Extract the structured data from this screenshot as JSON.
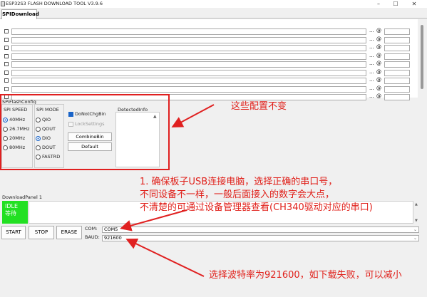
{
  "window": {
    "title": "ESP32S3 FLASH DOWNLOAD TOOL V3.9.6",
    "minimize": "–",
    "maximize": "☐",
    "close": "✕"
  },
  "tab": {
    "label": "SPIDownload"
  },
  "file_rows": {
    "count": 9,
    "dots_label": "...",
    "at_label": "@"
  },
  "spi_config": {
    "group_label": "SPIFlashConfig",
    "speed_label": "SPI SPEED",
    "speeds": [
      "40MHz",
      "26.7MHz",
      "20MHz",
      "80MHz"
    ],
    "speed_selected": "40MHz",
    "mode_label": "SPI MODE",
    "modes": [
      "QIO",
      "QOUT",
      "DIO",
      "DOUT",
      "FASTRD"
    ],
    "mode_selected": "DIO",
    "donotchgbin": "DoNotChgBin",
    "donotchgbin_checked": true,
    "locksettings": "LockSettings",
    "combinebin": "CombineBin",
    "default": "Default",
    "detected_info": "DetectedInfo"
  },
  "download_panel": {
    "label": "DownloadPanel 1",
    "status_en": "IDLE",
    "status_cn": "等待",
    "start": "START",
    "stop": "STOP",
    "erase": "ERASE",
    "com_label": "COM:",
    "com_value": "COM5",
    "baud_label": "BAUD:",
    "baud_value": "921600"
  },
  "annotations": {
    "config_note": "这些配置不变",
    "com_note_1": "1. 确保板子USB连接电脑，选择正确的串口号，",
    "com_note_2": "不同设备不一样，一般后面接入的数字会大点，",
    "com_note_3": "不清楚的可通过设备管理器查看(CH340驱动对应的串口)",
    "baud_note": "选择波特率为921600，如下载失败，可以减小",
    "color": "#e0201a"
  },
  "colors": {
    "idle_bg": "#22e022",
    "accent": "#1a64c8"
  }
}
